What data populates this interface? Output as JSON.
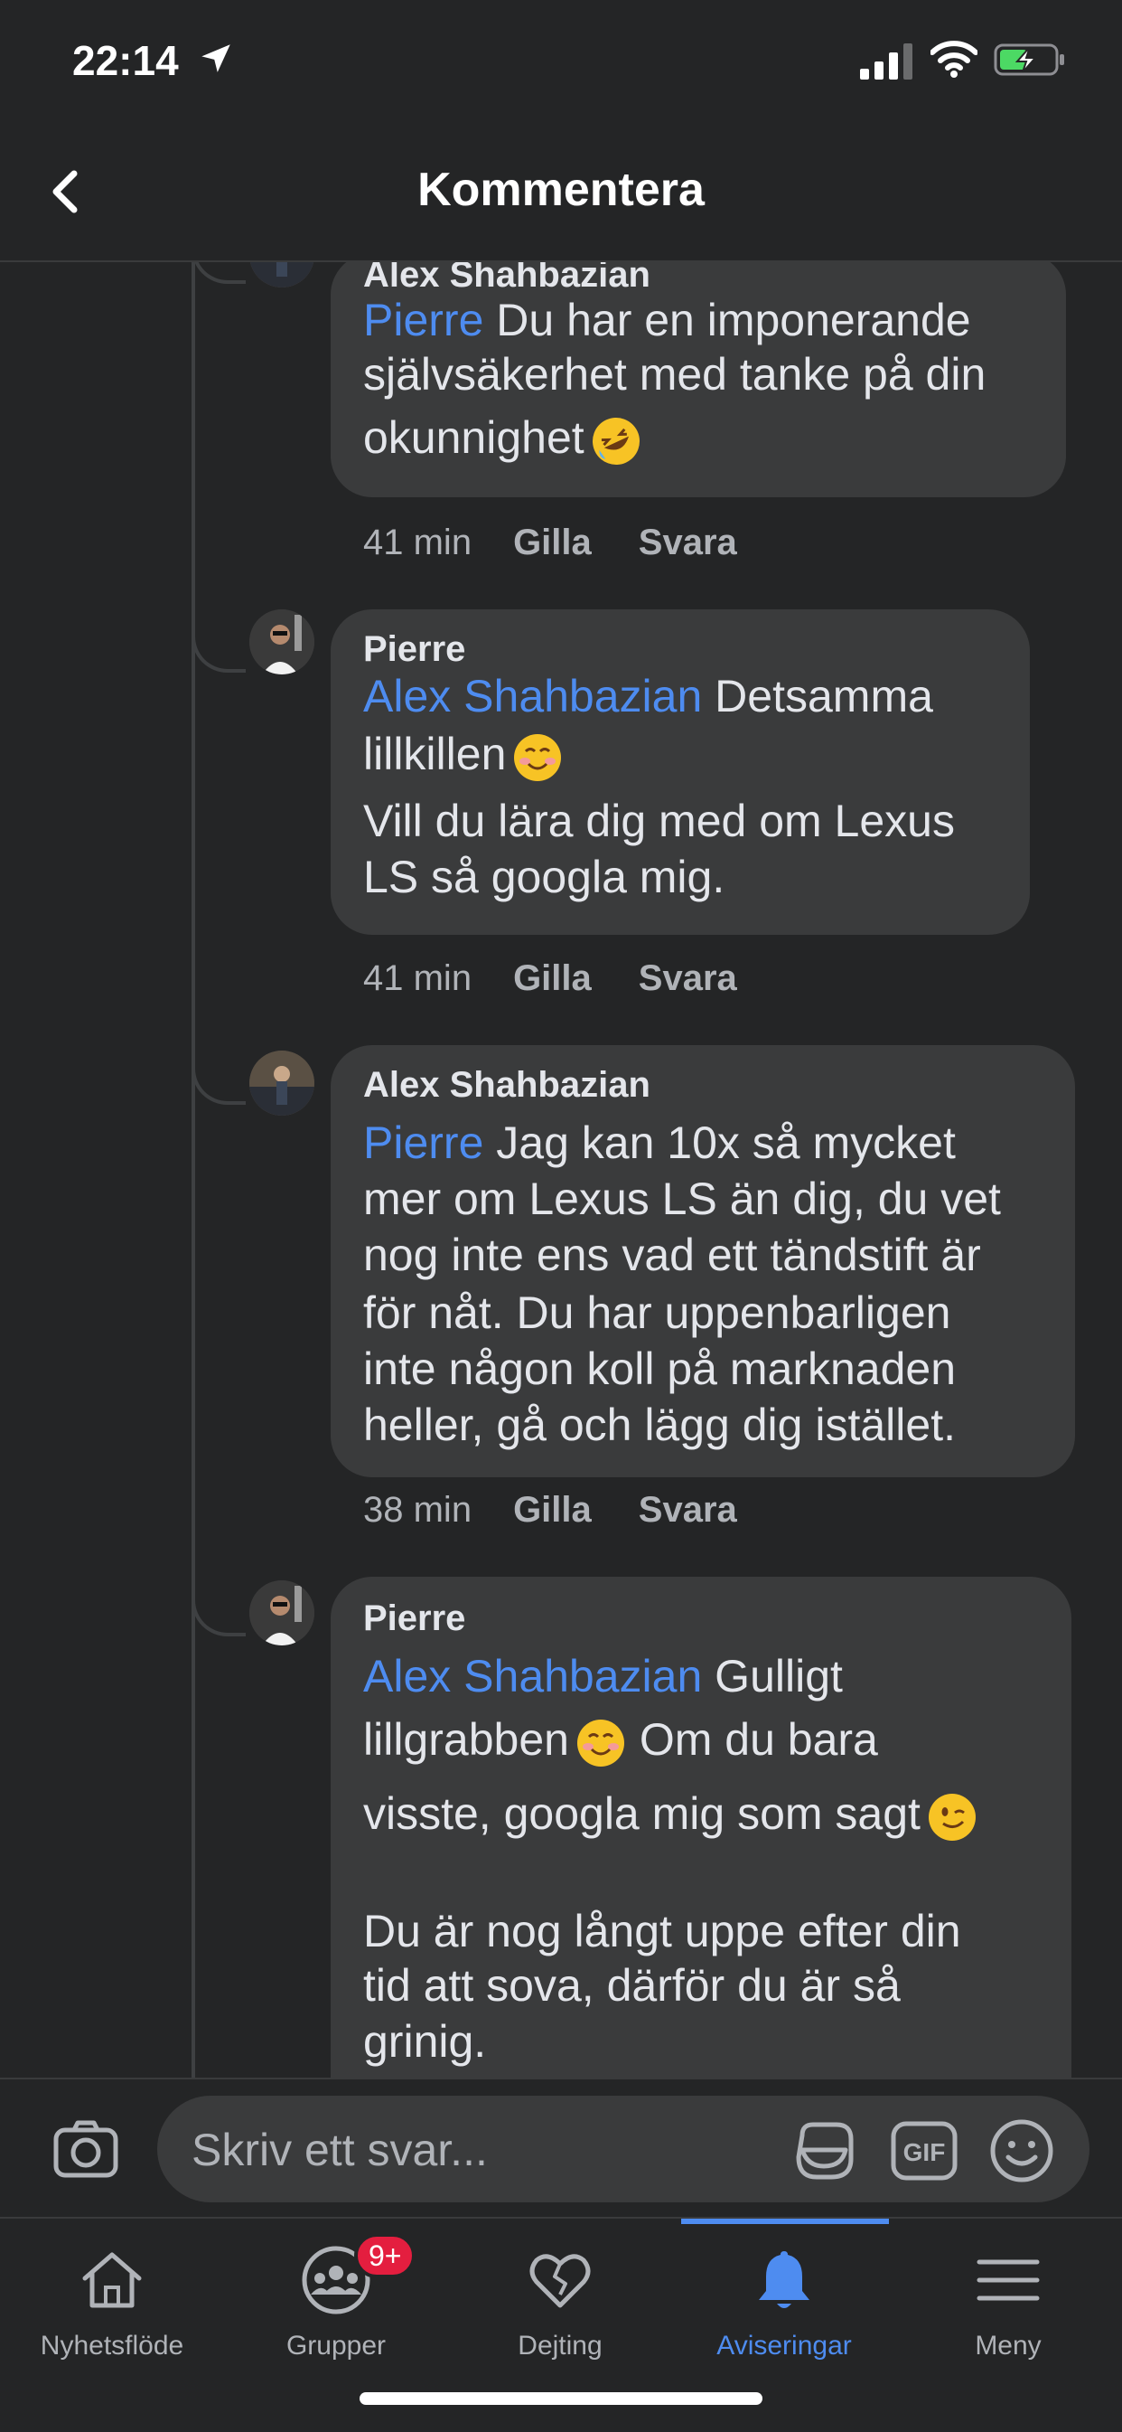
{
  "status_bar": {
    "time": "22:14"
  },
  "header": {
    "title": "Kommentera"
  },
  "comments": [
    {
      "author": "Alex Shahbazian",
      "lines": [
        {
          "mention": "Pierre",
          "text": " Du har en imponerande"
        },
        {
          "text": "självsäkerhet med tanke på din"
        },
        {
          "text": "okunnighet"
        }
      ],
      "emoji": "rolling-on-floor-laughing",
      "time": "41 min",
      "like_label": "Gilla",
      "reply_label": "Svara"
    },
    {
      "author": "Pierre",
      "lines": [
        {
          "mention": "Alex Shahbazian",
          "text": " Detsamma"
        },
        {
          "text": "lillkillen"
        },
        {
          "text": "Vill du lära dig med om Lexus"
        },
        {
          "text": "LS så googla mig."
        }
      ],
      "emoji": "smiling-face",
      "time": "41 min",
      "like_label": "Gilla",
      "reply_label": "Svara"
    },
    {
      "author": "Alex Shahbazian",
      "lines": [
        {
          "mention": "Pierre",
          "text": " Jag kan 10x så mycket"
        },
        {
          "text": "mer om Lexus LS än dig, du vet"
        },
        {
          "text": "nog inte ens vad ett tändstift är"
        },
        {
          "text": "för nåt. Du har uppenbarligen"
        },
        {
          "text": "inte någon koll på marknaden"
        },
        {
          "text": "heller, gå och lägg dig istället."
        }
      ],
      "time": "38 min",
      "like_label": "Gilla",
      "reply_label": "Svara"
    },
    {
      "author": "Pierre",
      "lines": [
        {
          "mention": "Alex Shahbazian",
          "text": " Gulligt"
        },
        {
          "text": "lillgrabben"
        },
        {
          "text": " Om du bara"
        },
        {
          "text": "visste, googla mig som sagt"
        },
        {
          "text": "Du är nog långt uppe efter din"
        },
        {
          "text": "tid att sova, därför du är så"
        },
        {
          "text": "grinig."
        }
      ],
      "emojis": [
        "smiling-face",
        "winking-face"
      ]
    }
  ],
  "composer": {
    "placeholder": "Skriv ett svar...",
    "gif_label": "GIF"
  },
  "tabs": [
    {
      "label": "Nyhetsflöde",
      "icon": "home-icon"
    },
    {
      "label": "Grupper",
      "icon": "groups-icon",
      "badge": "9+"
    },
    {
      "label": "Dejting",
      "icon": "heart-icon"
    },
    {
      "label": "Aviseringar",
      "icon": "bell-icon",
      "active": true
    },
    {
      "label": "Meny",
      "icon": "menu-icon"
    }
  ],
  "colors": {
    "background": "#242526",
    "bubble": "#3a3b3c",
    "mention": "#4e8cf0",
    "badge": "#e41e3f"
  }
}
